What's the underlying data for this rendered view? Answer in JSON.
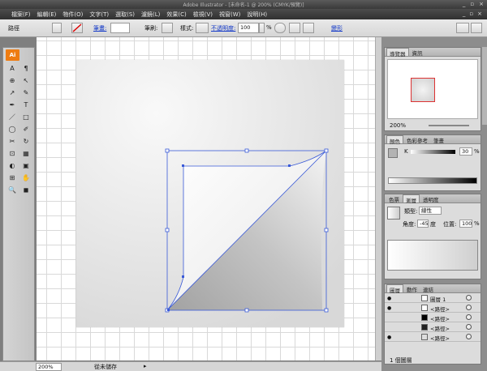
{
  "window": {
    "title": "Adobe Illustrator - [未命名-1 @ 200% (CMYK/預覽)]",
    "controls": [
      "_",
      "▫",
      "×"
    ]
  },
  "menu": {
    "items": [
      "檔案(F)",
      "編輯(E)",
      "物件(O)",
      "文字(T)",
      "選取(S)",
      "濾鏡(L)",
      "效果(C)",
      "檢視(V)",
      "視窗(W)",
      "說明(H)"
    ],
    "right_controls": [
      "_",
      "▫",
      "×"
    ]
  },
  "controlbar": {
    "selection_type": "路徑",
    "stroke_label": "筆畫:",
    "brush_label": "筆刷:",
    "style_label": "樣式:",
    "opacity_label": "不透明度:",
    "opacity_value": "100",
    "percent": "%",
    "transform_label": "變形"
  },
  "tools": {
    "logo": "Ai",
    "glyphs": [
      "A",
      "¶",
      "⊕",
      "↖",
      "↗",
      "✎",
      "✒",
      "T",
      "／",
      "□",
      "◯",
      "✐",
      "✂",
      "↻",
      "⊡",
      "▦",
      "◐",
      "▣",
      "⊞",
      "✋",
      "🔍",
      "◼"
    ]
  },
  "status": {
    "zoom": "200%",
    "save_status": "從未儲存"
  },
  "navigator": {
    "tabs": [
      "導覽器",
      "資訊"
    ],
    "zoom": "200%"
  },
  "color": {
    "tabs": [
      "顏色",
      "色彩參考",
      "筆畫"
    ],
    "channel": "K",
    "value": "30",
    "percent": "%"
  },
  "gradient": {
    "tabs": [
      "色票",
      "漸層",
      "透明度"
    ],
    "type_label": "類型:",
    "type_value": "線性",
    "angle_label": "角度:",
    "angle_value": "-45",
    "degree": "度",
    "location_label": "位置:",
    "location_value": "100",
    "percent": "%"
  },
  "layers": {
    "tabs": [
      "圖層",
      "動作",
      "連結"
    ],
    "rows": [
      {
        "name": "圖層 1"
      },
      {
        "name": "<路徑>"
      },
      {
        "name": "<路徑>"
      },
      {
        "name": "<路徑>"
      },
      {
        "name": "<路徑>"
      }
    ],
    "footer": "1 個圖層"
  },
  "colors": {
    "selection": "#3a5ad8",
    "accent": "#ee7c12"
  }
}
